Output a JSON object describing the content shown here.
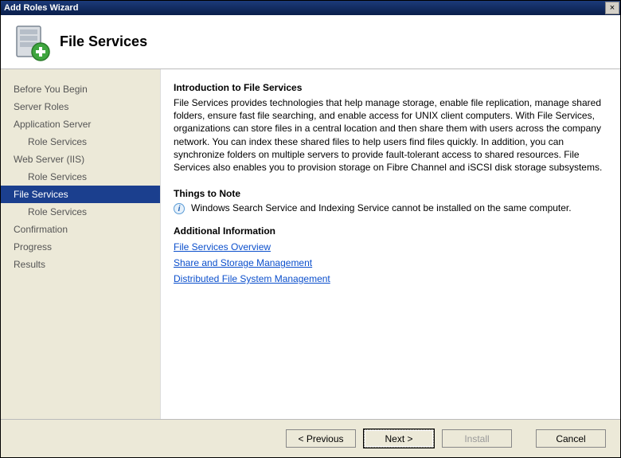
{
  "window": {
    "title": "Add Roles Wizard",
    "close": "×"
  },
  "header": {
    "pageTitle": "File Services"
  },
  "sidebar": {
    "items": [
      {
        "label": "Before You Begin",
        "indent": false
      },
      {
        "label": "Server Roles",
        "indent": false
      },
      {
        "label": "Application Server",
        "indent": false
      },
      {
        "label": "Role Services",
        "indent": true
      },
      {
        "label": "Web Server (IIS)",
        "indent": false
      },
      {
        "label": "Role Services",
        "indent": true
      },
      {
        "label": "File Services",
        "indent": false,
        "selected": true
      },
      {
        "label": "Role Services",
        "indent": true
      },
      {
        "label": "Confirmation",
        "indent": false
      },
      {
        "label": "Progress",
        "indent": false
      },
      {
        "label": "Results",
        "indent": false
      }
    ]
  },
  "content": {
    "introHeading": "Introduction to File Services",
    "introBody": "File Services provides technologies that help manage storage, enable file replication, manage shared folders, ensure fast file searching, and enable access for UNIX client computers. With File Services, organizations can store files in a central location and then share them with users across the company network. You can index these shared files to help users find files quickly. In addition, you can synchronize folders on multiple servers to provide fault-tolerant access to shared resources. File Services also enables you to provision storage on Fibre Channel and iSCSI disk storage subsystems.",
    "notesHeading": "Things to Note",
    "noteText": "Windows Search Service and Indexing Service cannot be installed on the same computer.",
    "additionalHeading": "Additional Information",
    "links": [
      "File Services Overview",
      "Share and Storage Management",
      "Distributed File System Management"
    ]
  },
  "footer": {
    "previous": "< Previous",
    "next": "Next >",
    "install": "Install",
    "cancel": "Cancel"
  }
}
